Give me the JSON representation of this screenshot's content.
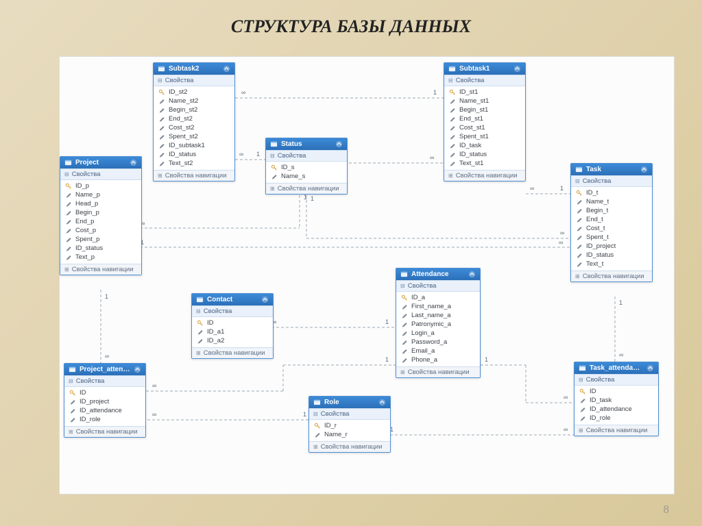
{
  "page_title": "СТРУКТУРА БАЗЫ ДАННЫХ",
  "page_number": "8",
  "section_properties": "Свойства",
  "section_nav": "Свойства навигации",
  "mult_one": "1",
  "mult_many": "∞",
  "entities": {
    "subtask2": {
      "title": "Subtask2",
      "fields": [
        {
          "k": true,
          "name": "ID_st2"
        },
        {
          "k": false,
          "name": "Name_st2"
        },
        {
          "k": false,
          "name": "Begin_st2"
        },
        {
          "k": false,
          "name": "End_st2"
        },
        {
          "k": false,
          "name": "Cost_st2"
        },
        {
          "k": false,
          "name": "Spent_st2"
        },
        {
          "k": false,
          "name": "ID_subtask1"
        },
        {
          "k": false,
          "name": "ID_status"
        },
        {
          "k": false,
          "name": "Text_st2"
        }
      ]
    },
    "subtask1": {
      "title": "Subtask1",
      "fields": [
        {
          "k": true,
          "name": "ID_st1"
        },
        {
          "k": false,
          "name": "Name_st1"
        },
        {
          "k": false,
          "name": "Begin_st1"
        },
        {
          "k": false,
          "name": "End_st1"
        },
        {
          "k": false,
          "name": "Cost_st1"
        },
        {
          "k": false,
          "name": "Spent_st1"
        },
        {
          "k": false,
          "name": "ID_task"
        },
        {
          "k": false,
          "name": "ID_status"
        },
        {
          "k": false,
          "name": "Text_st1"
        }
      ]
    },
    "status": {
      "title": "Status",
      "fields": [
        {
          "k": true,
          "name": "ID_s"
        },
        {
          "k": false,
          "name": "Name_s"
        }
      ]
    },
    "project": {
      "title": "Project",
      "fields": [
        {
          "k": true,
          "name": "ID_p"
        },
        {
          "k": false,
          "name": "Name_p"
        },
        {
          "k": false,
          "name": "Head_p"
        },
        {
          "k": false,
          "name": "Begin_p"
        },
        {
          "k": false,
          "name": "End_p"
        },
        {
          "k": false,
          "name": "Cost_p"
        },
        {
          "k": false,
          "name": "Spent_p"
        },
        {
          "k": false,
          "name": "ID_status"
        },
        {
          "k": false,
          "name": "Text_p"
        }
      ]
    },
    "task": {
      "title": "Task",
      "fields": [
        {
          "k": true,
          "name": "ID_t"
        },
        {
          "k": false,
          "name": "Name_t"
        },
        {
          "k": false,
          "name": "Begin_t"
        },
        {
          "k": false,
          "name": "End_t"
        },
        {
          "k": false,
          "name": "Cost_t"
        },
        {
          "k": false,
          "name": "Spent_t"
        },
        {
          "k": false,
          "name": "ID_project"
        },
        {
          "k": false,
          "name": "ID_status"
        },
        {
          "k": false,
          "name": "Text_t"
        }
      ]
    },
    "contact": {
      "title": "Contact",
      "fields": [
        {
          "k": true,
          "name": "ID"
        },
        {
          "k": false,
          "name": "ID_a1"
        },
        {
          "k": false,
          "name": "ID_a2"
        }
      ]
    },
    "attendance": {
      "title": "Attendance",
      "fields": [
        {
          "k": true,
          "name": "ID_a"
        },
        {
          "k": false,
          "name": "First_name_a"
        },
        {
          "k": false,
          "name": "Last_name_a"
        },
        {
          "k": false,
          "name": "Patronymic_a"
        },
        {
          "k": false,
          "name": "Login_a"
        },
        {
          "k": false,
          "name": "Password_a"
        },
        {
          "k": false,
          "name": "Email_a"
        },
        {
          "k": false,
          "name": "Phone_a"
        }
      ]
    },
    "project_atten": {
      "title": "Project_atten…",
      "fields": [
        {
          "k": true,
          "name": "ID"
        },
        {
          "k": false,
          "name": "ID_project"
        },
        {
          "k": false,
          "name": "ID_attendance"
        },
        {
          "k": false,
          "name": "ID_role"
        }
      ]
    },
    "role": {
      "title": "Role",
      "fields": [
        {
          "k": true,
          "name": "ID_r"
        },
        {
          "k": false,
          "name": "Name_r"
        }
      ]
    },
    "task_attendan": {
      "title": "Task_attendan…",
      "fields": [
        {
          "k": true,
          "name": "ID"
        },
        {
          "k": false,
          "name": "ID_task"
        },
        {
          "k": false,
          "name": "ID_attendance"
        },
        {
          "k": false,
          "name": "ID_role"
        }
      ]
    }
  }
}
